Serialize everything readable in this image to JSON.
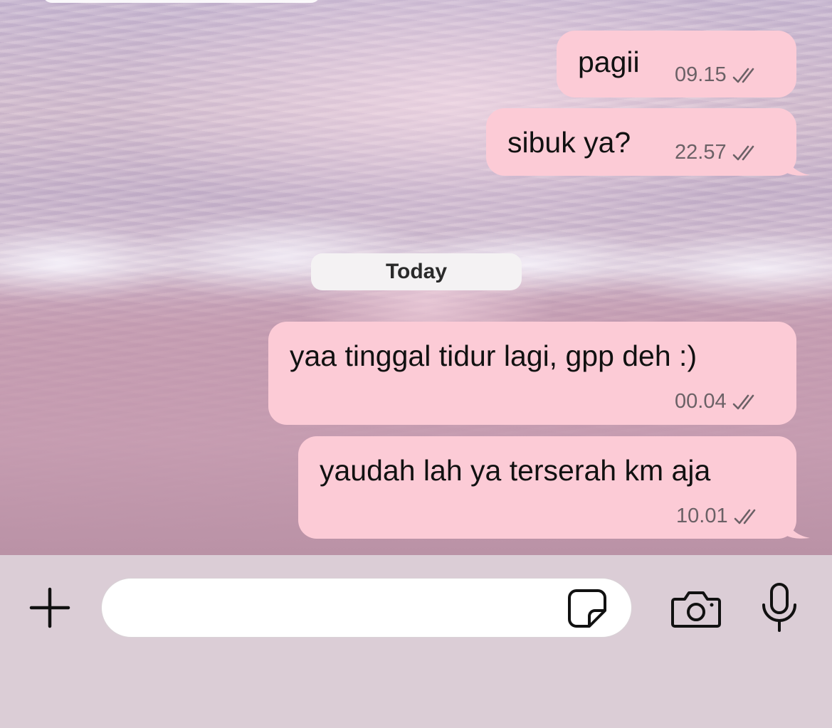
{
  "colors": {
    "bubble_outgoing": "#fccbd6",
    "meta_text": "#6b6166",
    "input_bar": "#dbcdd6",
    "date_chip": "#f4f2f3"
  },
  "messages_before": [
    {
      "text": "pagii",
      "time": "09.15",
      "status_icon": "double-check-icon"
    },
    {
      "text": "sibuk ya?",
      "time": "22.57",
      "status_icon": "double-check-icon"
    }
  ],
  "date_separator": "Today",
  "messages_today": [
    {
      "text": "yaa tinggal tidur lagi, gpp deh :)",
      "time": "00.04",
      "status_icon": "double-check-icon"
    },
    {
      "text": "yaudah lah ya terserah km aja",
      "time": "10.01",
      "status_icon": "double-check-icon"
    }
  ],
  "composer": {
    "placeholder": "",
    "icons": [
      "plus-icon",
      "sticker-icon",
      "camera-icon",
      "microphone-icon"
    ]
  }
}
